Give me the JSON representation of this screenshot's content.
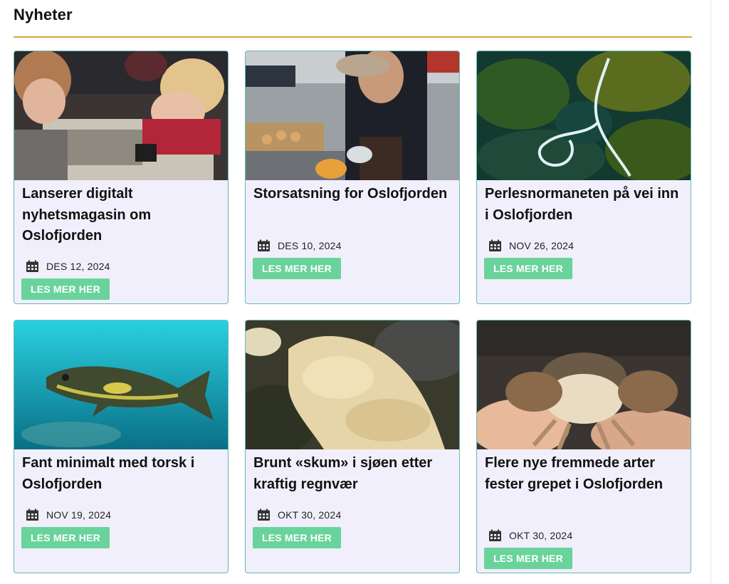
{
  "section": {
    "title": "Nyheter"
  },
  "icons": {
    "date": "calendar-icon"
  },
  "colors": {
    "accent_rule": "#d9a93b",
    "button": "#69d39b",
    "card_bg": "#f1effc",
    "card_border": "#67b9b6"
  },
  "cards": [
    {
      "title": "Lanserer digitalt nyhetsmagasin om Oslofjorden",
      "date": "DES 12, 2024",
      "button": "LES MER HER",
      "image": "students-at-table-photo"
    },
    {
      "title": "Storsatsning for Oslofjorden",
      "date": "DES 10, 2024",
      "button": "LES MER HER",
      "image": "fisherman-on-pier-photo"
    },
    {
      "title": "Perlesnormaneten på vei inn i Oslofjorden",
      "date": "NOV 26, 2024",
      "button": "LES MER HER",
      "image": "jellyfish-string-in-seaweed-photo"
    },
    {
      "title": "Fant minimalt med torsk i Oslofjorden",
      "date": "NOV 19, 2024",
      "button": "LES MER HER",
      "image": "cod-underwater-photo"
    },
    {
      "title": "Brunt «skum» i sjøen etter kraftig regnvær",
      "date": "OKT 30, 2024",
      "button": "LES MER HER",
      "image": "brown-foam-on-rocks-photo"
    },
    {
      "title": "Flere nye fremmede arter fester grepet i Oslofjorden",
      "date": "OKT 30, 2024",
      "button": "LES MER HER",
      "image": "crab-in-hand-photo"
    }
  ]
}
